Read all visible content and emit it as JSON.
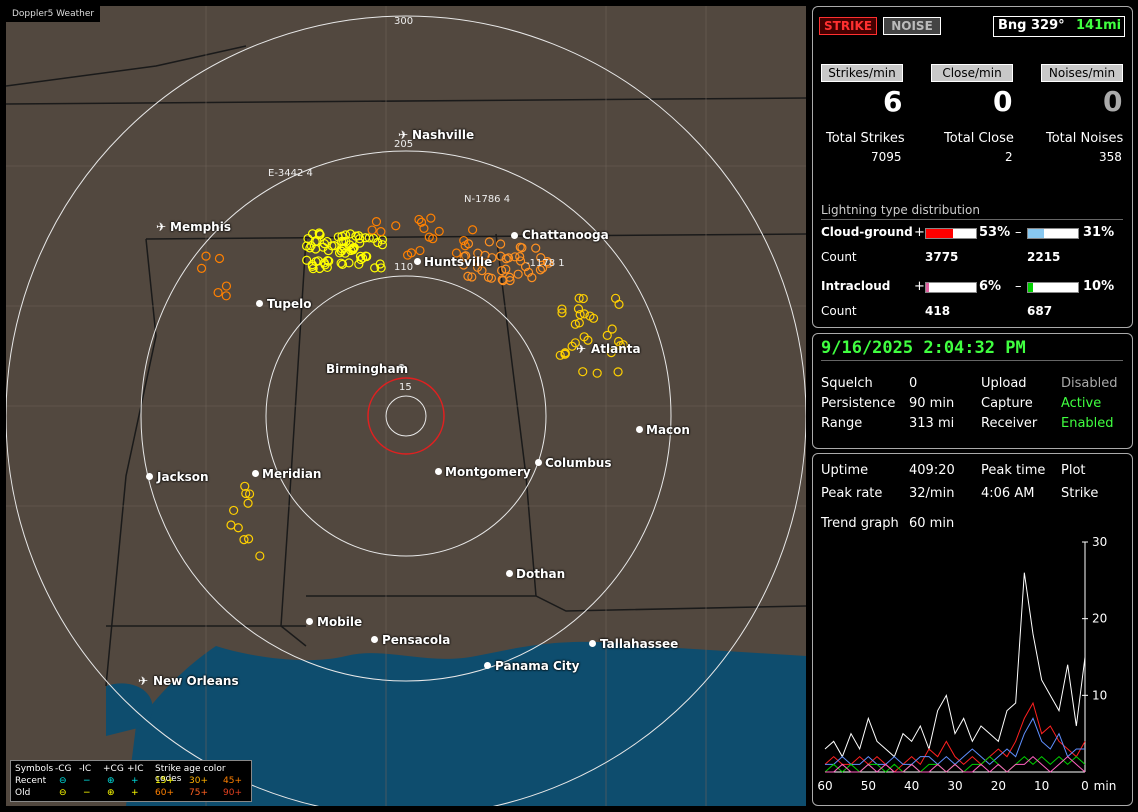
{
  "brand": "Doppler5 Weather",
  "header": {
    "strike_btn": "STRIKE",
    "noise_btn": "NOISE",
    "bearing": "Bng 329°",
    "distance": "141mi"
  },
  "rates": {
    "strikes_label": "Strikes/min",
    "strikes_value": "6",
    "close_label": "Close/min",
    "close_value": "0",
    "noises_label": "Noises/min",
    "noises_value": "0"
  },
  "totals": {
    "strikes_label": "Total Strikes",
    "strikes_value": "7095",
    "close_label": "Total Close",
    "close_value": "2",
    "noises_label": "Total Noises",
    "noises_value": "358"
  },
  "distribution": {
    "title": "Lightning type distribution",
    "cg_label": "Cloud-ground",
    "cg_pos_sign": "+",
    "cg_pos_pct": "53%",
    "cg_pos_frac": 0.53,
    "cg_neg_sign": "–",
    "cg_neg_pct": "31%",
    "cg_neg_frac": 0.31,
    "count_label": "Count",
    "cg_pos_count": "3775",
    "cg_neg_count": "2215",
    "ic_label": "Intracloud",
    "ic_pos_sign": "+",
    "ic_pos_pct": "6%",
    "ic_pos_frac": 0.06,
    "ic_neg_sign": "–",
    "ic_neg_pct": "10%",
    "ic_neg_frac": 0.1,
    "ic_pos_count": "418",
    "ic_neg_count": "687",
    "colors": {
      "cg_pos": "#ff0000",
      "cg_neg": "#88c8f0",
      "ic_pos": "#e060a0",
      "ic_neg": "#00d000"
    }
  },
  "status": {
    "datetime": "9/16/2025 2:04:32 PM",
    "squelch_label": "Squelch",
    "squelch_value": "0",
    "persistence_label": "Persistence",
    "persistence_value": "90 min",
    "range_label": "Range",
    "range_value": "313 mi",
    "upload_label": "Upload",
    "upload_value": "Disabled",
    "capture_label": "Capture",
    "capture_value": "Active",
    "receiver_label": "Receiver",
    "receiver_value": "Enabled"
  },
  "stats": {
    "uptime_label": "Uptime",
    "uptime_value": "409:20",
    "peaktime_label": "Peak time",
    "peaktime_value": "4:06 AM",
    "plot_label": "Plot",
    "plot_value": "Strike",
    "peakrate_label": "Peak rate",
    "peakrate_value": "32/min",
    "trend_label": "Trend graph",
    "trend_value": "60 min"
  },
  "map": {
    "rings": {
      "r300": "300",
      "r205": "205",
      "r110": "110",
      "r15": "15"
    },
    "cities": [
      {
        "name": "Nashville"
      },
      {
        "name": "Memphis"
      },
      {
        "name": "Chattanooga"
      },
      {
        "name": "Huntsville"
      },
      {
        "name": "Tupelo"
      },
      {
        "name": "Atlanta"
      },
      {
        "name": "Birmingham"
      },
      {
        "name": "Macon"
      },
      {
        "name": "Jackson"
      },
      {
        "name": "Meridian"
      },
      {
        "name": "Montgomery"
      },
      {
        "name": "Columbus"
      },
      {
        "name": "Dothan"
      },
      {
        "name": "Mobile"
      },
      {
        "name": "Pensacola"
      },
      {
        "name": "Tallahassee"
      },
      {
        "name": "Panama City"
      },
      {
        "name": "New Orleans"
      }
    ],
    "markers": {
      "e": "E-3442  4",
      "n1": "N-1786  4",
      "n2": "-1178  1"
    },
    "legend": {
      "symbols": "Symbols",
      "cg_neg": "-CG",
      "ic_neg": "-IC",
      "cg_pos": "+CG",
      "ic_pos": "+IC",
      "age_title": "Strike age color codes",
      "recent": "Recent",
      "old": "Old",
      "a15": "15+",
      "a30": "30+",
      "a45": "45+",
      "a60": "60+",
      "a75": "75+",
      "a90": "90+"
    }
  },
  "chart_data": {
    "type": "line",
    "x_ticks": [
      "60",
      "50",
      "40",
      "30",
      "20",
      "10",
      "0"
    ],
    "x_unit": "min",
    "y_ticks": [
      "30",
      "20",
      "10"
    ],
    "ylim": [
      0,
      30
    ],
    "x": [
      60,
      58,
      56,
      54,
      52,
      50,
      48,
      46,
      44,
      42,
      40,
      38,
      36,
      34,
      32,
      30,
      28,
      26,
      24,
      22,
      20,
      18,
      16,
      14,
      12,
      10,
      8,
      6,
      4,
      2,
      0
    ],
    "series": [
      {
        "color": "#ffffff",
        "values": [
          3,
          4,
          2,
          5,
          3,
          7,
          4,
          3,
          2,
          5,
          4,
          6,
          3,
          8,
          10,
          5,
          7,
          4,
          6,
          5,
          4,
          8,
          9,
          26,
          18,
          12,
          10,
          8,
          14,
          6,
          15
        ]
      },
      {
        "color": "#ff2020",
        "values": [
          1,
          2,
          1,
          1,
          2,
          1,
          2,
          1,
          0,
          1,
          2,
          1,
          3,
          2,
          4,
          2,
          1,
          2,
          1,
          2,
          3,
          2,
          4,
          7,
          9,
          5,
          6,
          4,
          3,
          2,
          4
        ]
      },
      {
        "color": "#6090ff",
        "values": [
          1,
          1,
          2,
          1,
          1,
          2,
          1,
          1,
          2,
          1,
          1,
          2,
          2,
          1,
          2,
          1,
          2,
          3,
          2,
          1,
          2,
          3,
          2,
          5,
          7,
          4,
          3,
          5,
          2,
          3,
          3
        ]
      },
      {
        "color": "#00d000",
        "values": [
          0,
          1,
          0,
          1,
          0,
          1,
          1,
          0,
          1,
          0,
          1,
          0,
          1,
          1,
          0,
          1,
          0,
          1,
          1,
          2,
          1,
          0,
          1,
          2,
          1,
          2,
          1,
          2,
          1,
          2,
          1
        ]
      },
      {
        "color": "#ff60c0",
        "values": [
          0,
          0,
          1,
          0,
          0,
          1,
          0,
          1,
          0,
          0,
          1,
          0,
          0,
          1,
          0,
          1,
          0,
          0,
          1,
          0,
          1,
          0,
          1,
          1,
          2,
          1,
          0,
          1,
          2,
          1,
          0
        ]
      }
    ]
  }
}
